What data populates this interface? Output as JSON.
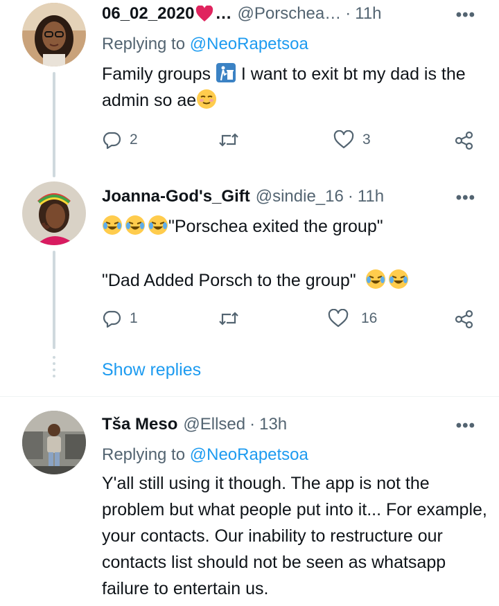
{
  "tweets": [
    {
      "name": "06_02_2020",
      "name_suffix": "…",
      "handle": "@Porschea…",
      "time": "11h",
      "replying_label": "Replying to",
      "replying_to": "@NeoRapetsoa",
      "text_a": "Family groups",
      "text_b": "I want to exit bt my dad is the admin so ae",
      "replies": "2",
      "retweets": "",
      "likes": "3"
    },
    {
      "name": "Joanna-God's_Gift",
      "handle": "@sindie_16",
      "time": "11h",
      "text_line1": "\"Porschea exited the group\"",
      "text_line2": "\"Dad Added Porsch to the group\"",
      "replies": "1",
      "retweets": "",
      "likes": "16"
    },
    {
      "name": "Tša Meso",
      "handle": "@Ellsed",
      "time": "13h",
      "replying_label": "Replying to",
      "replying_to": "@NeoRapetsoa",
      "text": "Y'all still using it though. The app is not the problem but what people put into it... For example, your contacts. Our inability to restructure our contacts list should not be seen as whatsapp failure to entertain us."
    }
  ],
  "show_replies": "Show replies",
  "separator_dot": "·",
  "more_glyph": "•••",
  "icons": [
    "reply-icon",
    "retweet-icon",
    "like-icon",
    "share-icon",
    "more-icon",
    "heart-emoji",
    "trash-icon",
    "laughing-emoji",
    "relieved-emoji"
  ],
  "colors": {
    "link": "#1d9bf0",
    "muted": "#536471",
    "text": "#0f1419",
    "heart": "#e0245e",
    "thread_line": "#cfd9de"
  }
}
